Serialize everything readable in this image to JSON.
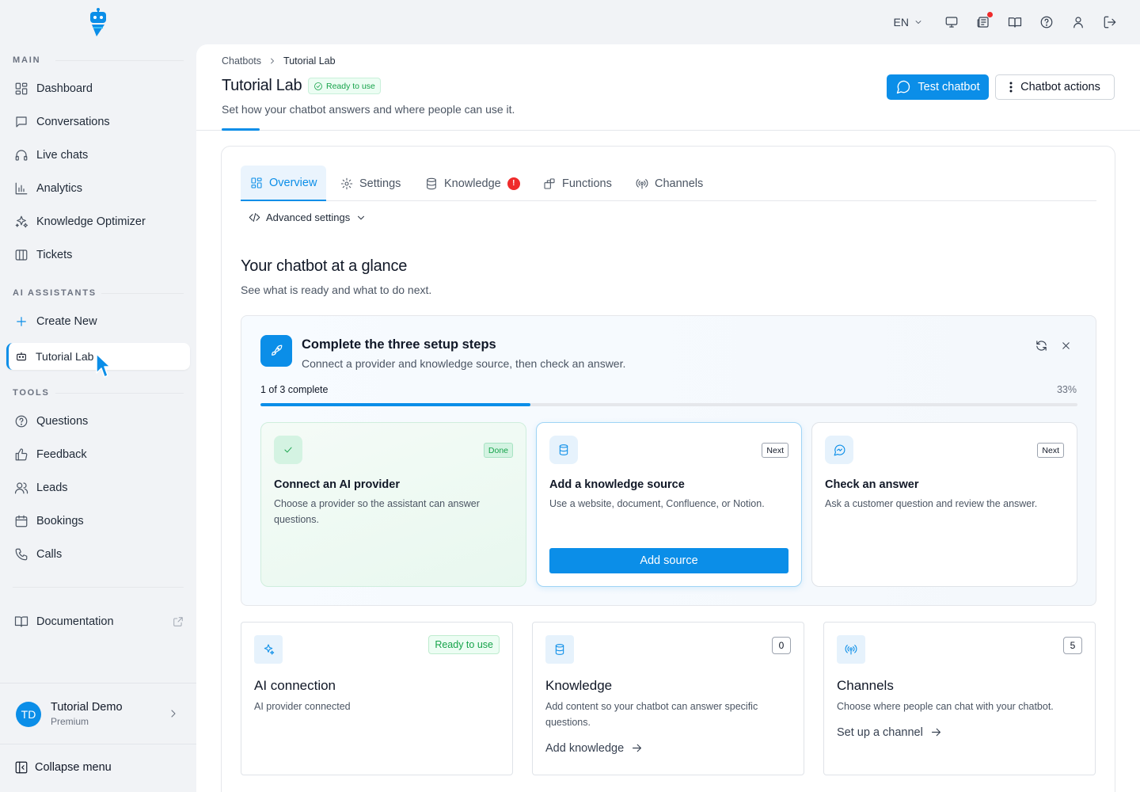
{
  "app": {
    "brand_color": "#0b8ee8",
    "success_color": "#16a34a"
  },
  "topbar": {
    "language": "EN",
    "icons": [
      "monitor-icon",
      "news-icon",
      "book-open-icon",
      "help-icon",
      "user-icon",
      "logout-icon"
    ]
  },
  "sidebar": {
    "main_title": "MAIN",
    "main_items": [
      {
        "label": "Dashboard",
        "icon": "dashboard-icon"
      },
      {
        "label": "Conversations",
        "icon": "chat-icon"
      },
      {
        "label": "Live chats",
        "icon": "headset-icon"
      },
      {
        "label": "Analytics",
        "icon": "bar-chart-icon"
      },
      {
        "label": "Knowledge Optimizer",
        "icon": "sparkles-icon"
      },
      {
        "label": "Tickets",
        "icon": "columns-icon"
      }
    ],
    "assistants_title": "AI ASSISTANTS",
    "create_new": "Create New",
    "active_bot": "Tutorial Lab",
    "tools_title": "TOOLS",
    "tools_items": [
      {
        "label": "Questions",
        "icon": "question-circle-icon"
      },
      {
        "label": "Feedback",
        "icon": "thumbs-up-icon"
      },
      {
        "label": "Leads",
        "icon": "users-icon"
      },
      {
        "label": "Bookings",
        "icon": "calendar-icon"
      },
      {
        "label": "Calls",
        "icon": "phone-icon"
      }
    ],
    "documentation": "Documentation",
    "user": {
      "initials": "TD",
      "name": "Tutorial Demo",
      "plan": "Premium"
    },
    "collapse": "Collapse menu"
  },
  "header": {
    "breadcrumb_root": "Chatbots",
    "breadcrumb_current": "Tutorial Lab",
    "title": "Tutorial Lab",
    "status": "Ready to use",
    "subtitle": "Set how your chatbot answers and where people can use it.",
    "test_button": "Test chatbot",
    "actions_button": "Chatbot actions"
  },
  "tabs": [
    {
      "label": "Overview",
      "active": true
    },
    {
      "label": "Settings"
    },
    {
      "label": "Knowledge",
      "badge": "!"
    },
    {
      "label": "Functions"
    },
    {
      "label": "Channels"
    }
  ],
  "advanced_settings": "Advanced settings",
  "glance": {
    "title": "Your chatbot at a glance",
    "subtitle": "See what is ready and what to do next."
  },
  "setup": {
    "title": "Complete the three setup steps",
    "subtitle": "Connect a provider and knowledge source, then check an answer.",
    "progress_label": "1 of 3 complete",
    "progress_percent": "33%",
    "progress_value": 0.33,
    "steps": [
      {
        "tag": "Done",
        "title": "Connect an AI provider",
        "desc": "Choose a provider so the assistant can answer questions."
      },
      {
        "tag": "Next",
        "title": "Add a knowledge source",
        "desc": "Use a website, document, Confluence, or Notion.",
        "button": "Add source"
      },
      {
        "tag": "Next",
        "title": "Check an answer",
        "desc": "Ask a customer question and review the answer."
      }
    ]
  },
  "cards": [
    {
      "title": "AI connection",
      "desc": "AI provider connected",
      "tag": "Ready to use"
    },
    {
      "title": "Knowledge",
      "desc": "Add content so your chatbot can answer specific questions.",
      "count": "0",
      "link": "Add knowledge"
    },
    {
      "title": "Channels",
      "desc": "Choose where people can chat with your chatbot.",
      "count": "5",
      "link": "Set up a channel"
    }
  ]
}
